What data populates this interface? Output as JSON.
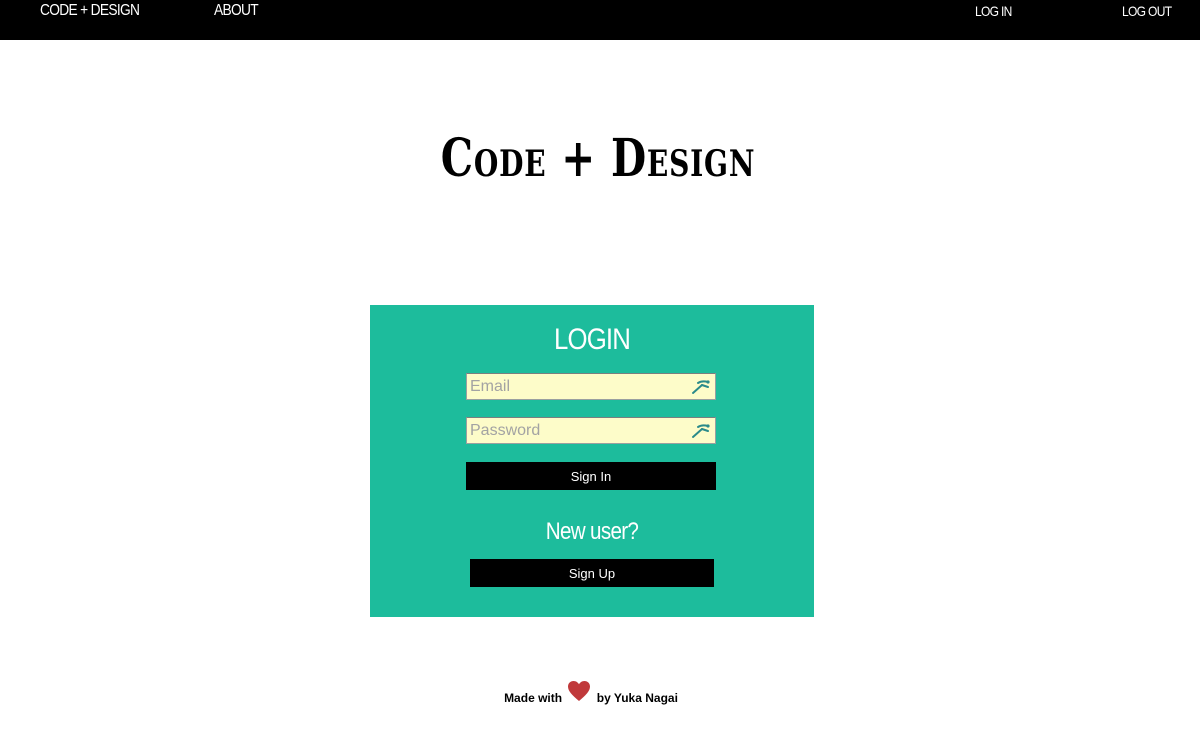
{
  "nav": {
    "brand": "CODE + DESIGN",
    "about": "ABOUT",
    "login": "LOG IN",
    "logout": "LOG OUT"
  },
  "site_title": "Code + Design",
  "login": {
    "heading": "LOGIN",
    "email_placeholder": "Email",
    "password_placeholder": "Password",
    "signin_label": "Sign In",
    "new_user_text": "New user?",
    "signup_label": "Sign Up"
  },
  "footer": {
    "prefix": "Made with",
    "suffix": "by Yuka Nagai"
  },
  "icons": {
    "field_icon": "key-icon",
    "footer_icon": "heart-icon"
  },
  "colors": {
    "nav_background": "#000000",
    "panel_background": "#1dbc9c",
    "field_background": "#fdfcc9",
    "button_background": "#000000",
    "heart": "#c0393b"
  }
}
